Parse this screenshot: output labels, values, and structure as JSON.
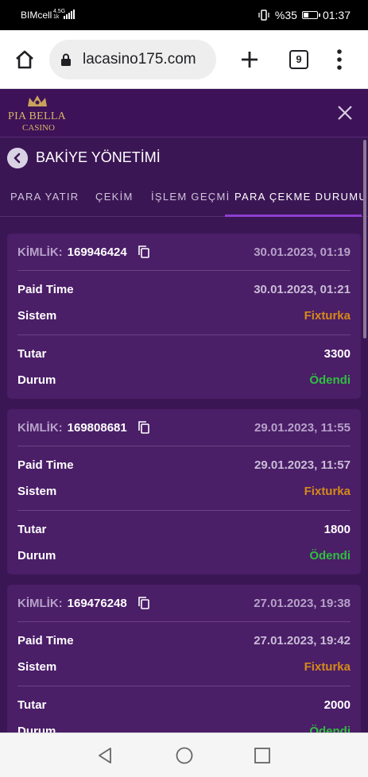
{
  "status_bar": {
    "carrier": "BIMcell",
    "network_small": "4.5G",
    "speed_small": "1k",
    "battery": "%35",
    "time": "01:37",
    "vibrate_icon": "vibrate-icon",
    "battery_icon": "battery-icon"
  },
  "browser": {
    "url": "lacasino175.com",
    "tab_count": "9",
    "home_icon": "home-icon",
    "lock_icon": "lock-icon",
    "plus_icon": "plus-icon",
    "menu_icon": "more-vertical-icon"
  },
  "site": {
    "logo_line1": "PIA BELLA",
    "logo_line2": "CASINO",
    "brand_gold": "#d9b56a",
    "bg_purple": "#3b1654"
  },
  "section": {
    "title": "BAKİYE YÖNETİMİ"
  },
  "tabs": [
    {
      "label": "PARA YATIR",
      "active": false
    },
    {
      "label": "ÇEKİM",
      "active": false
    },
    {
      "label": "İŞLEM GEÇMİ",
      "active": false
    },
    {
      "label": "PARA ÇEKME DURUMU",
      "active": true
    }
  ],
  "labels": {
    "kimlik": "KİMLİK:",
    "paid_time": "Paid Time",
    "sistem": "Sistem",
    "tutar": "Tutar",
    "durum": "Durum"
  },
  "withdrawals": [
    {
      "id": "169946424",
      "date": "30.01.2023, 01:19",
      "paid_time": "30.01.2023, 01:21",
      "sistem": "Fixturka",
      "tutar": "3300",
      "durum": "Ödendi"
    },
    {
      "id": "169808681",
      "date": "29.01.2023, 11:55",
      "paid_time": "29.01.2023, 11:57",
      "sistem": "Fixturka",
      "tutar": "1800",
      "durum": "Ödendi"
    },
    {
      "id": "169476248",
      "date": "27.01.2023, 19:38",
      "paid_time": "27.01.2023, 19:42",
      "sistem": "Fixturka",
      "tutar": "2000",
      "durum": "Ödendi"
    }
  ],
  "colors": {
    "status_paid": "#2fbf3f",
    "system_name": "#d58a17",
    "active_tab": "#8d3fd1"
  }
}
